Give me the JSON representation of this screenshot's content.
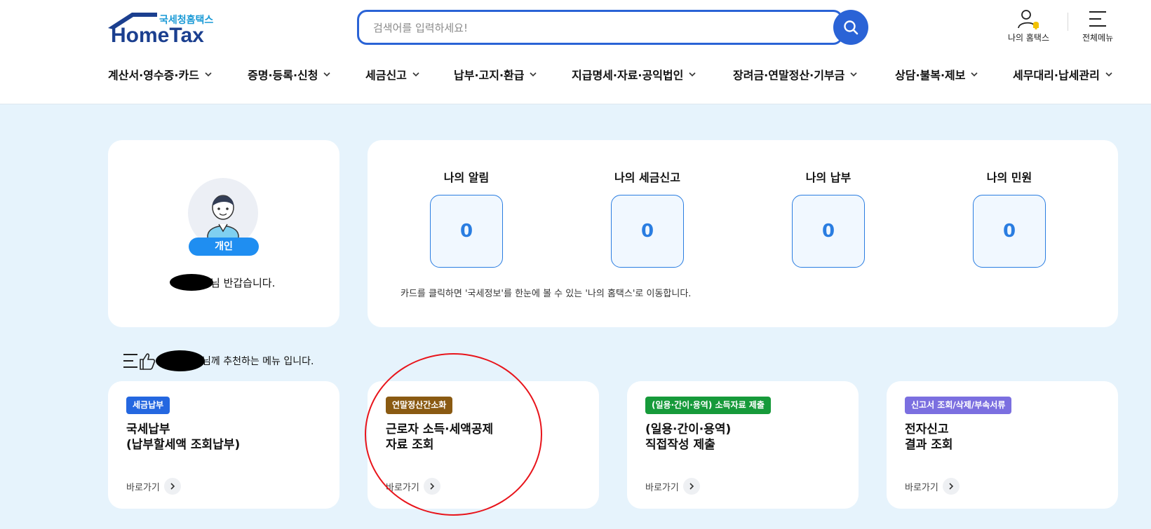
{
  "logo": {
    "sub": "국세청홈택스",
    "main": "HomeTax"
  },
  "search": {
    "placeholder": "검색어를 입력하세요!"
  },
  "util": {
    "my_hometax": "나의 홈택스",
    "all_menu": "전체메뉴"
  },
  "nav": [
    {
      "label": "계산서·영수증·카드"
    },
    {
      "label": "증명·등록·신청"
    },
    {
      "label": "세금신고"
    },
    {
      "label": "납부·고지·환급"
    },
    {
      "label": "지급명세·자료·공익법인"
    },
    {
      "label": "장려금·연말정산·기부금"
    },
    {
      "label": "상담·불복·제보"
    },
    {
      "label": "세무대리·납세관리"
    }
  ],
  "profile": {
    "badge": "개인",
    "greeting": "님 반갑습니다."
  },
  "summary": {
    "items": [
      {
        "title": "나의 알림",
        "count": "0"
      },
      {
        "title": "나의 세금신고",
        "count": "0"
      },
      {
        "title": "나의 납부",
        "count": "0"
      },
      {
        "title": "나의 민원",
        "count": "0"
      }
    ],
    "note": "카드를 클릭하면 '국세정보'를 한눈에 볼 수 있는 '나의 홈택스'로 이동합니다."
  },
  "recommend": {
    "heading": "님께 추천하는 메뉴 입니다."
  },
  "menu_cards": [
    {
      "tag": "세금납부",
      "tag_color": "#2467e0",
      "title1": "국세납부",
      "title2": "(납부할세액 조회납부)",
      "link": "바로가기"
    },
    {
      "tag": "연말정산간소화",
      "tag_color": "#8a5a12",
      "title1": "근로자 소득·세액공제",
      "title2": "자료 조회",
      "link": "바로가기"
    },
    {
      "tag": "(일용·간이·용역) 소득자료 제출",
      "tag_color": "#169a3a",
      "title1": "(일용·간이·용역)",
      "title2": "직접작성 제출",
      "link": "바로가기"
    },
    {
      "tag": "신고서 조회/삭제/부속서류",
      "tag_color": "#7b6fe0",
      "title1": "전자신고",
      "title2": "결과 조회",
      "link": "바로가기"
    }
  ],
  "colors": {
    "primary": "#2a63d6",
    "accent": "#2a7de1",
    "background": "#e6f3fc",
    "annotation": "#e8141b"
  }
}
